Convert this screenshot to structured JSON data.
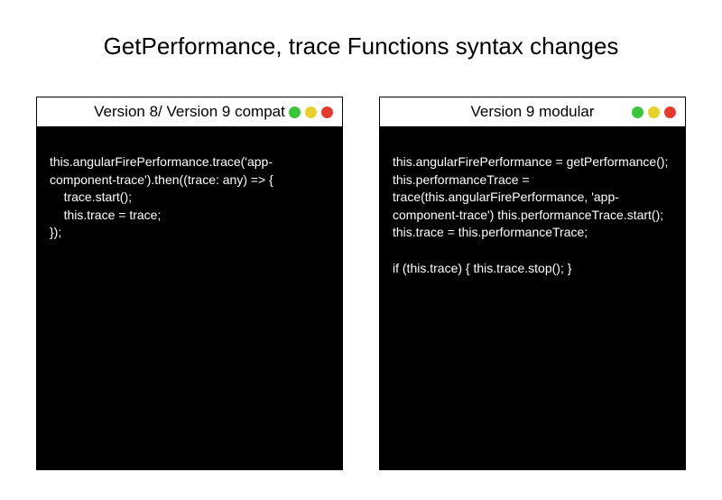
{
  "title": "GetPerformance, trace Functions syntax changes",
  "trafficColors": {
    "green": "#39c639",
    "yellow": "#e8d22a",
    "red": "#e73a2f"
  },
  "panels": {
    "left": {
      "title": "Version 8/ Version 9 compat",
      "code": "this.angularFirePerformance.trace('app-component-trace').then((trace: any) => {\n    trace.start();\n    this.trace = trace;\n});"
    },
    "right": {
      "title": "Version 9 modular",
      "code": "this.angularFirePerformance = getPerformance(); this.performanceTrace = trace(this.angularFirePerformance, 'app-component-trace') this.performanceTrace.start(); this.trace = this.performanceTrace;\n\nif (this.trace) { this.trace.stop(); }"
    }
  }
}
